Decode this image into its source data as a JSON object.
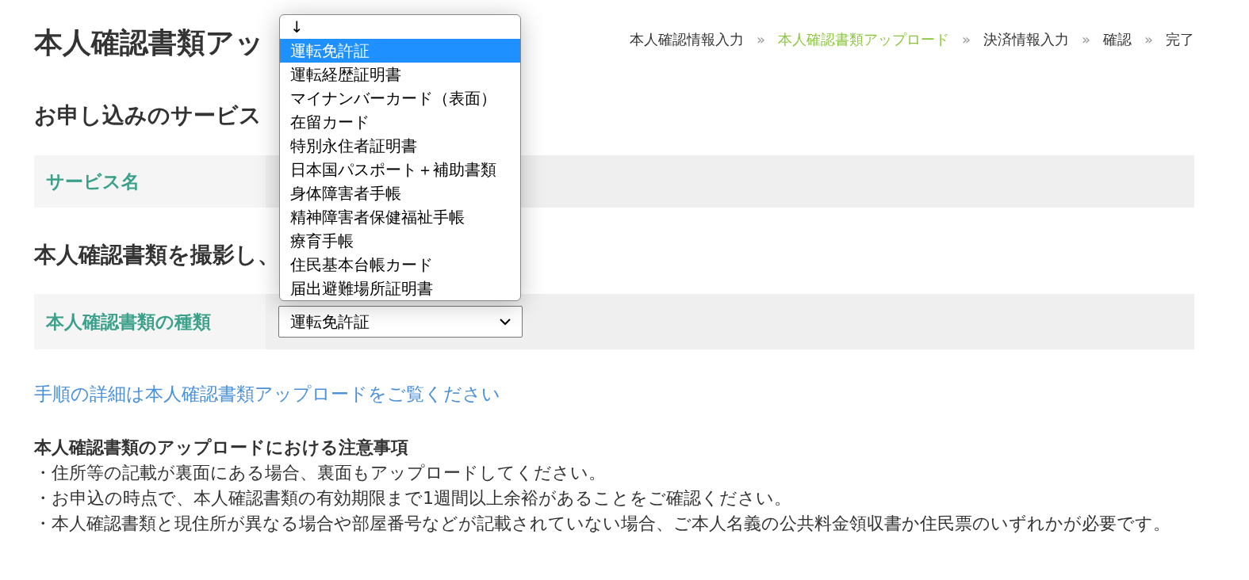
{
  "page_title": "本人確認書類アッ",
  "breadcrumb": [
    {
      "label": "本人確認情報入力",
      "selected": false
    },
    {
      "label": "本人確認書類アップロード",
      "selected": true
    },
    {
      "label": "決済情報入力",
      "selected": false
    },
    {
      "label": "確認",
      "selected": false
    },
    {
      "label": "完了",
      "selected": false
    }
  ],
  "breadcrumb_separator": "»",
  "service_section": {
    "heading": "お申し込みのサービス",
    "label": "サービス名"
  },
  "document_section": {
    "heading": "本人確認書類を撮影し、",
    "label": "本人確認書類の種類",
    "select_value": "運転免許証"
  },
  "dropdown_options": [
    {
      "label": "↓",
      "selected": false
    },
    {
      "label": "運転免許証",
      "selected": true
    },
    {
      "label": "運転経歴証明書",
      "selected": false
    },
    {
      "label": "マイナンバーカード（表面）",
      "selected": false
    },
    {
      "label": "在留カード",
      "selected": false
    },
    {
      "label": "特別永住者証明書",
      "selected": false
    },
    {
      "label": "日本国パスポート＋補助書類",
      "selected": false
    },
    {
      "label": "身体障害者手帳",
      "selected": false
    },
    {
      "label": "精神障害者保健福祉手帳",
      "selected": false
    },
    {
      "label": "療育手帳",
      "selected": false
    },
    {
      "label": "住民基本台帳カード",
      "selected": false
    },
    {
      "label": "届出避難場所証明書",
      "selected": false
    }
  ],
  "details_link": "手順の詳細は本人確認書類アップロードをご覧ください",
  "notes": {
    "title": "本人確認書類のアップロードにおける注意事項",
    "items": [
      "・住所等の記載が裏面にある場合、裏面もアップロードしてください。",
      "・お申込の時点で、本人確認書類の有効期限まで1週間以上余裕があることをご確認ください。",
      "・本人確認書類と現住所が異なる場合や部屋番号などが記載されていない場合、ご本人名義の公共料金領収書か住民票のいずれかが必要です。"
    ]
  }
}
